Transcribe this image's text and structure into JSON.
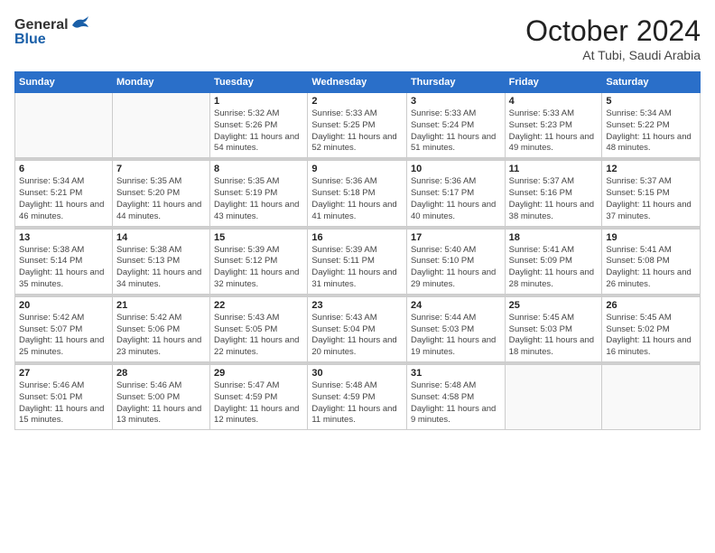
{
  "logo": {
    "general": "General",
    "blue": "Blue"
  },
  "title": "October 2024",
  "subtitle": "At Tubi, Saudi Arabia",
  "days_of_week": [
    "Sunday",
    "Monday",
    "Tuesday",
    "Wednesday",
    "Thursday",
    "Friday",
    "Saturday"
  ],
  "weeks": [
    [
      {
        "day": "",
        "info": ""
      },
      {
        "day": "",
        "info": ""
      },
      {
        "day": "1",
        "info": "Sunrise: 5:32 AM\nSunset: 5:26 PM\nDaylight: 11 hours and 54 minutes."
      },
      {
        "day": "2",
        "info": "Sunrise: 5:33 AM\nSunset: 5:25 PM\nDaylight: 11 hours and 52 minutes."
      },
      {
        "day": "3",
        "info": "Sunrise: 5:33 AM\nSunset: 5:24 PM\nDaylight: 11 hours and 51 minutes."
      },
      {
        "day": "4",
        "info": "Sunrise: 5:33 AM\nSunset: 5:23 PM\nDaylight: 11 hours and 49 minutes."
      },
      {
        "day": "5",
        "info": "Sunrise: 5:34 AM\nSunset: 5:22 PM\nDaylight: 11 hours and 48 minutes."
      }
    ],
    [
      {
        "day": "6",
        "info": "Sunrise: 5:34 AM\nSunset: 5:21 PM\nDaylight: 11 hours and 46 minutes."
      },
      {
        "day": "7",
        "info": "Sunrise: 5:35 AM\nSunset: 5:20 PM\nDaylight: 11 hours and 44 minutes."
      },
      {
        "day": "8",
        "info": "Sunrise: 5:35 AM\nSunset: 5:19 PM\nDaylight: 11 hours and 43 minutes."
      },
      {
        "day": "9",
        "info": "Sunrise: 5:36 AM\nSunset: 5:18 PM\nDaylight: 11 hours and 41 minutes."
      },
      {
        "day": "10",
        "info": "Sunrise: 5:36 AM\nSunset: 5:17 PM\nDaylight: 11 hours and 40 minutes."
      },
      {
        "day": "11",
        "info": "Sunrise: 5:37 AM\nSunset: 5:16 PM\nDaylight: 11 hours and 38 minutes."
      },
      {
        "day": "12",
        "info": "Sunrise: 5:37 AM\nSunset: 5:15 PM\nDaylight: 11 hours and 37 minutes."
      }
    ],
    [
      {
        "day": "13",
        "info": "Sunrise: 5:38 AM\nSunset: 5:14 PM\nDaylight: 11 hours and 35 minutes."
      },
      {
        "day": "14",
        "info": "Sunrise: 5:38 AM\nSunset: 5:13 PM\nDaylight: 11 hours and 34 minutes."
      },
      {
        "day": "15",
        "info": "Sunrise: 5:39 AM\nSunset: 5:12 PM\nDaylight: 11 hours and 32 minutes."
      },
      {
        "day": "16",
        "info": "Sunrise: 5:39 AM\nSunset: 5:11 PM\nDaylight: 11 hours and 31 minutes."
      },
      {
        "day": "17",
        "info": "Sunrise: 5:40 AM\nSunset: 5:10 PM\nDaylight: 11 hours and 29 minutes."
      },
      {
        "day": "18",
        "info": "Sunrise: 5:41 AM\nSunset: 5:09 PM\nDaylight: 11 hours and 28 minutes."
      },
      {
        "day": "19",
        "info": "Sunrise: 5:41 AM\nSunset: 5:08 PM\nDaylight: 11 hours and 26 minutes."
      }
    ],
    [
      {
        "day": "20",
        "info": "Sunrise: 5:42 AM\nSunset: 5:07 PM\nDaylight: 11 hours and 25 minutes."
      },
      {
        "day": "21",
        "info": "Sunrise: 5:42 AM\nSunset: 5:06 PM\nDaylight: 11 hours and 23 minutes."
      },
      {
        "day": "22",
        "info": "Sunrise: 5:43 AM\nSunset: 5:05 PM\nDaylight: 11 hours and 22 minutes."
      },
      {
        "day": "23",
        "info": "Sunrise: 5:43 AM\nSunset: 5:04 PM\nDaylight: 11 hours and 20 minutes."
      },
      {
        "day": "24",
        "info": "Sunrise: 5:44 AM\nSunset: 5:03 PM\nDaylight: 11 hours and 19 minutes."
      },
      {
        "day": "25",
        "info": "Sunrise: 5:45 AM\nSunset: 5:03 PM\nDaylight: 11 hours and 18 minutes."
      },
      {
        "day": "26",
        "info": "Sunrise: 5:45 AM\nSunset: 5:02 PM\nDaylight: 11 hours and 16 minutes."
      }
    ],
    [
      {
        "day": "27",
        "info": "Sunrise: 5:46 AM\nSunset: 5:01 PM\nDaylight: 11 hours and 15 minutes."
      },
      {
        "day": "28",
        "info": "Sunrise: 5:46 AM\nSunset: 5:00 PM\nDaylight: 11 hours and 13 minutes."
      },
      {
        "day": "29",
        "info": "Sunrise: 5:47 AM\nSunset: 4:59 PM\nDaylight: 11 hours and 12 minutes."
      },
      {
        "day": "30",
        "info": "Sunrise: 5:48 AM\nSunset: 4:59 PM\nDaylight: 11 hours and 11 minutes."
      },
      {
        "day": "31",
        "info": "Sunrise: 5:48 AM\nSunset: 4:58 PM\nDaylight: 11 hours and 9 minutes."
      },
      {
        "day": "",
        "info": ""
      },
      {
        "day": "",
        "info": ""
      }
    ]
  ]
}
